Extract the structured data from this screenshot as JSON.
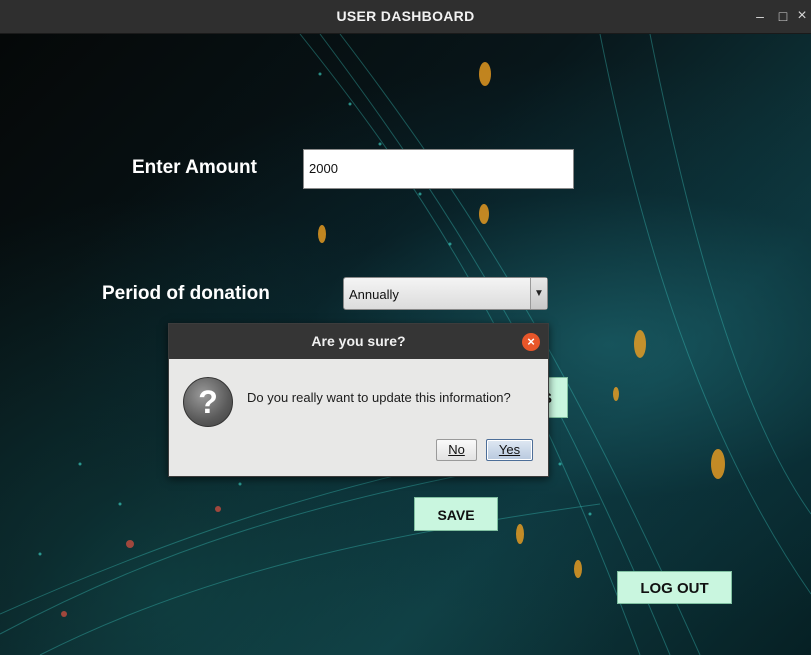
{
  "window": {
    "title": "USER DASHBOARD",
    "minimize_glyph": "–",
    "maximize_glyph": "□",
    "close_glyph": "×"
  },
  "form": {
    "amount_label": "Enter Amount",
    "amount_value": "2000",
    "period_label": "Period of donation",
    "period_selected": "Annually",
    "dropdown_arrow": "▼"
  },
  "buttons": {
    "hidden_partial_label": "S",
    "save_label": "SAVE",
    "logout_label": "LOG OUT"
  },
  "dialog": {
    "title": "Are you sure?",
    "close_glyph": "×",
    "icon": "question-icon",
    "icon_glyph": "?",
    "message": "Do you really want to update this information?",
    "no_label": "No",
    "yes_label": "Yes"
  },
  "colors": {
    "button_green": "#c9f6df",
    "dialog_close": "#e8562a",
    "titlebar": "#2f2f2f"
  }
}
